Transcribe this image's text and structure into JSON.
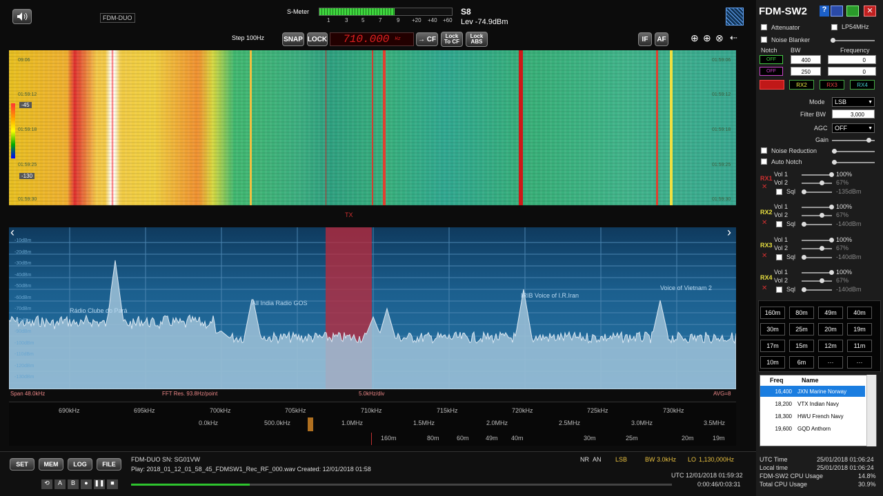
{
  "app": {
    "title": "FDM-SW2",
    "device": "FDM-DUO"
  },
  "toolbar": {
    "smeter_label": "S-Meter",
    "smeter_reading": "S8",
    "smeter_level": "Lev -74.9dBm",
    "smeter_ticks": [
      "1",
      "3",
      "5",
      "7",
      "9",
      "+20",
      "+40",
      "+60"
    ],
    "smeter_fill_pct": 57,
    "step": "Step 100Hz",
    "snap": "SNAP",
    "lock": "LOCK",
    "frequency": "710.000",
    "freq_unit": "Hz",
    "cf": "→ CF",
    "lock_to_cf": "Lock To CF",
    "lock_abs": "Lock ABS",
    "if": "IF",
    "af": "AF"
  },
  "waterfall": {
    "times_left": [
      "09:06",
      "01:59:12",
      "01:59:18",
      "01:59:25",
      "01:59:30"
    ],
    "times_right": [
      "01:59:06",
      "01:59:12",
      "01:59:18",
      "01:59:25",
      "01:59:30"
    ],
    "scale_top": "-45",
    "scale_bottom": "-130",
    "tx_label": "TX"
  },
  "spectrum": {
    "db_labels": [
      "-10dBm",
      "-20dBm",
      "-30dBm",
      "-40dBm",
      "-50dBm",
      "-60dBm",
      "-70dBm",
      "-80dBm",
      "-90dBm",
      "-100dBm",
      "-110dBm",
      "-120dBm",
      "-130dBm"
    ],
    "signals": [
      "Rádio Clube do Pará",
      "All India Radio GOS",
      "IRIB Voice of I.R.Iran",
      "Voice of Vietnam 2"
    ],
    "span": "Span 48.0kHz",
    "fft_res": "FFT Res. 93.8Hz/point",
    "div": "5.0kHz/div",
    "avg": "AVG=8"
  },
  "axis": {
    "khz": [
      "690kHz",
      "695kHz",
      "700kHz",
      "705kHz",
      "710kHz",
      "715kHz",
      "720kHz",
      "725kHz",
      "730kHz"
    ],
    "mhz": [
      "0.0kHz",
      "500.0kHz",
      "1.0MHz",
      "1.5MHz",
      "2.0MHz",
      "2.5MHz",
      "3.0MHz",
      "3.5MHz"
    ],
    "meters": [
      "160m",
      "80m",
      "60m",
      "49m",
      "40m",
      "30m",
      "25m",
      "20m",
      "19m"
    ]
  },
  "panel": {
    "attenuator": "Attenuator",
    "lp54": "LP54MHz",
    "noise_blanker": "Noise Blanker",
    "notch": "Notch",
    "bw": "BW",
    "frequency": "Frequency",
    "notch1_state": "OFF",
    "notch1_bw": "400",
    "notch1_freq": "0",
    "notch2_state": "OFF",
    "notch2_bw": "250",
    "notch2_freq": "0",
    "rx_tabs": [
      "RX2",
      "RX3",
      "RX4"
    ],
    "mode_label": "Mode",
    "mode": "LSB",
    "filter_bw_label": "Filter BW",
    "filter_bw": "3,000",
    "agc_label": "AGC",
    "agc": "OFF",
    "gain": "Gain",
    "noise_reduction": "Noise Reduction",
    "auto_notch": "Auto Notch",
    "rx": [
      {
        "name": "RX1",
        "vol1": "Vol 1",
        "vol1_val": "100%",
        "vol2": "Vol 2",
        "vol2_val": "67%",
        "sql": "Sql",
        "sql_val": "-135dBm"
      },
      {
        "name": "RX2",
        "vol1": "Vol 1",
        "vol1_val": "100%",
        "vol2": "Vol 2",
        "vol2_val": "67%",
        "sql": "Sql",
        "sql_val": "-140dBm"
      },
      {
        "name": "RX3",
        "vol1": "Vol 1",
        "vol1_val": "100%",
        "vol2": "Vol 2",
        "vol2_val": "67%",
        "sql": "Sql",
        "sql_val": "-140dBm"
      },
      {
        "name": "RX4",
        "vol1": "Vol 1",
        "vol1_val": "100%",
        "vol2": "Vol 2",
        "vol2_val": "67%",
        "sql": "Sql",
        "sql_val": "-140dBm"
      }
    ],
    "bands": [
      "160m",
      "80m",
      "49m",
      "40m",
      "30m",
      "25m",
      "20m",
      "19m",
      "17m",
      "15m",
      "12m",
      "11m",
      "10m",
      "6m",
      "···",
      "···"
    ],
    "table_headers": [
      "Freq",
      "Name"
    ],
    "table_rows": [
      {
        "freq": "16,400",
        "name": "JXN Marine Norway"
      },
      {
        "freq": "18,200",
        "name": "VTX Indian Navy"
      },
      {
        "freq": "18,300",
        "name": "HWU French Navy"
      },
      {
        "freq": "19,600",
        "name": "GQD Anthorn"
      }
    ],
    "utc_time_label": "UTC Time",
    "utc_time": "25/01/2018 01:06:24",
    "local_time_label": "Local time",
    "local_time": "25/01/2018 01:06:24",
    "cpu_label": "FDM-SW2 CPU Usage",
    "cpu": "14.8%",
    "total_cpu_label": "Total CPU Usage",
    "total_cpu": "30.9%"
  },
  "status": {
    "set": "SET",
    "mem": "MEM",
    "log": "LOG",
    "file": "FILE",
    "serial": "FDM-DUO SN: SG01VW",
    "playback": "Play: 2018_01_12_01_58_45_FDMSW1_Rec_RF_000.wav Created: 12/01/2018 01:58",
    "nr": "NR",
    "an": "AN",
    "mode": "LSB",
    "bw": "BW 3.0kHz",
    "lo": "LO",
    "lo_val": "1,130,000Hz",
    "utc": "UTC 12/01/2018 01:59:32",
    "elapsed": "0:00:46/0:03:31",
    "progress_pct": 22
  }
}
